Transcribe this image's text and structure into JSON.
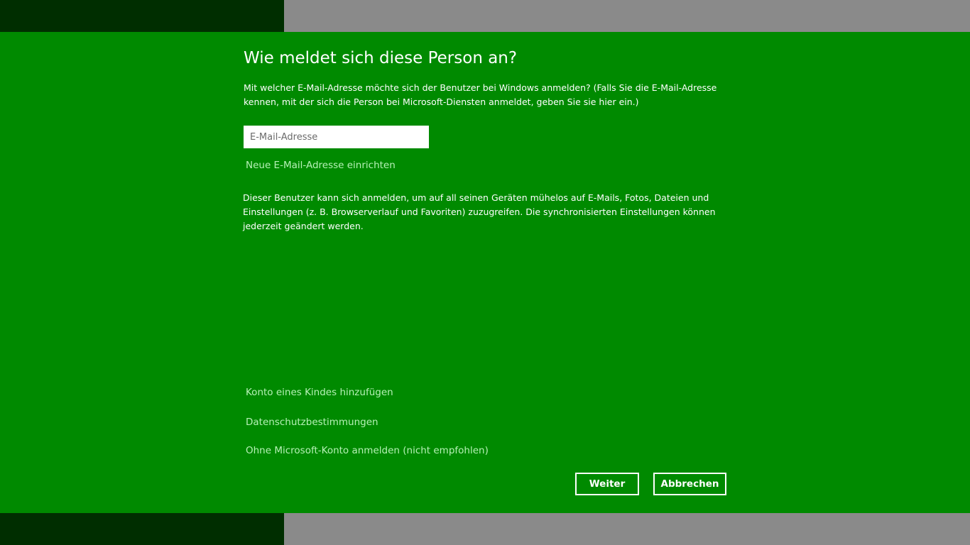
{
  "dialog": {
    "title": "Wie meldet sich diese Person an?",
    "intro": "Mit welcher E-Mail-Adresse möchte sich der Benutzer bei Windows anmelden? (Falls Sie die E-Mail-Adresse kennen, mit der sich die Person bei Microsoft-Diensten anmeldet, geben Sie sie hier ein.)",
    "email": {
      "placeholder": "E-Mail-Adresse",
      "value": ""
    },
    "new_email_link": "Neue E-Mail-Adresse einrichten",
    "sync_text": "Dieser Benutzer kann sich anmelden, um auf all seinen Geräten mühelos auf E-Mails, Fotos, Dateien und Einstellungen (z. B. Browserverlauf und Favoriten) zuzugreifen. Die synchronisierten Einstellungen können jederzeit geändert werden.",
    "links": {
      "child_account": "Konto eines Kindes hinzufügen",
      "privacy": "Datenschutzbestimmungen",
      "local_account": "Ohne Microsoft-Konto anmelden (nicht empfohlen)"
    },
    "buttons": {
      "next": "Weiter",
      "cancel": "Abbrechen"
    }
  },
  "colors": {
    "accent_green": "#008a00",
    "dark_green": "#002e00",
    "backdrop_gray": "#8a8a8a",
    "link_green": "#b6f1b6"
  }
}
